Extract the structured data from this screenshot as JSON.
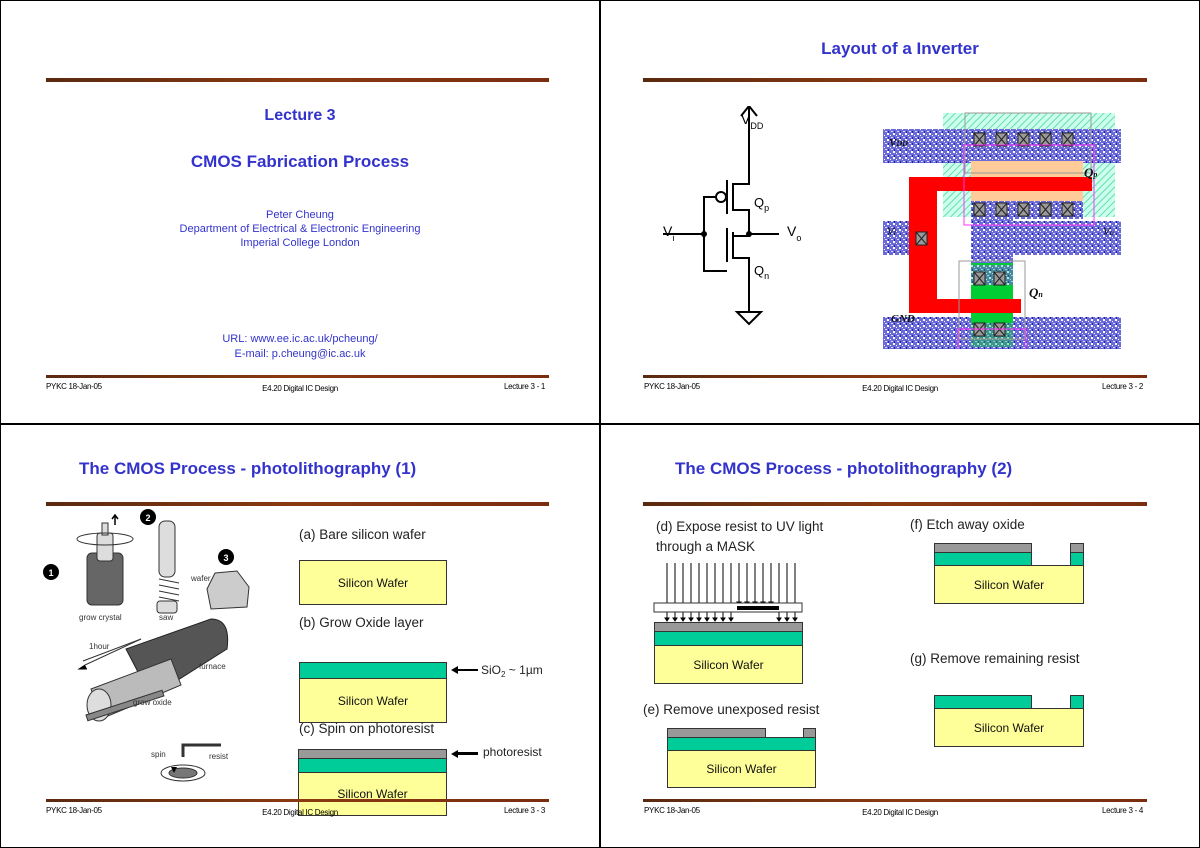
{
  "footer": {
    "left": "PYKC 18-Jan-05",
    "center": "E4.20 Digital IC Design"
  },
  "slides": [
    {
      "page": "Lecture 3 - 1",
      "lecture": "Lecture 3",
      "title": "CMOS Fabrication Process",
      "author": "Peter Cheung",
      "department": "Department of Electrical & Electronic Engineering",
      "institution": "Imperial College London",
      "url": "URL: www.ee.ic.ac.uk/pcheung/",
      "email": "E-mail: p.cheung@ic.ac.uk"
    },
    {
      "page": "Lecture 3 - 2",
      "title": "Layout of a Inverter",
      "schematic": {
        "vdd": "V",
        "vdd_sub": "DD",
        "vi": "V",
        "vi_sub": "i",
        "vo": "V",
        "vo_sub": "o",
        "qp": "Q",
        "qp_sub": "p",
        "qn": "Q",
        "qn_sub": "n"
      },
      "layout": {
        "vdd_label": "V",
        "vdd_sub": "DD",
        "vi_label": "V",
        "vi_sub": "i",
        "vo_label": "V",
        "vo_sub": "o",
        "gnd_label": "GND",
        "qp_label": "Q",
        "qp_sub": "p",
        "qn_label": "Q",
        "qn_sub": "n"
      }
    },
    {
      "page": "Lecture 3 - 3",
      "title": "The CMOS Process - photolithography (1)",
      "illustration": {
        "steps": [
          "1",
          "2",
          "3"
        ],
        "grow_crystal": "grow crystal",
        "saw": "saw",
        "wafer": "wafer",
        "one_hour": "1hour",
        "furnace": "furnace",
        "grow_oxide": "grow oxide",
        "spin": "spin",
        "resist": "resist"
      },
      "step_a": "(a) Bare silicon wafer",
      "step_b": "(b) Grow Oxide layer",
      "step_c": "(c) Spin on photoresist",
      "wafer_label": "Silicon Wafer",
      "sio2_label": "SiO",
      "sio2_sub": "2",
      "sio2_thickness": " ~ 1µm",
      "photoresist_label": "photoresist"
    },
    {
      "page": "Lecture 3 - 4",
      "title": "The CMOS Process - photolithography (2)",
      "step_d_line1": "(d) Expose resist to UV light",
      "step_d_line2": "through a MASK",
      "step_e": "(e) Remove unexposed resist",
      "step_f": "(f) Etch away oxide",
      "step_g": "(g) Remove remaining resist",
      "wafer_label": "Silicon Wafer"
    }
  ],
  "colors": {
    "title_blue": "#3333cc",
    "rule_brown": "#7a3410",
    "silicon_yellow": "#ffff99",
    "oxide_green": "#00cc99",
    "resist_gray": "#999999",
    "poly_red": "#ff0000",
    "metal_blue": "#3333cc",
    "pdiff_tan": "#ffcc99",
    "ndiff_green": "#00cc33",
    "nwell_hatch": "#99ffcc",
    "select_magenta": "#ff33ff"
  }
}
